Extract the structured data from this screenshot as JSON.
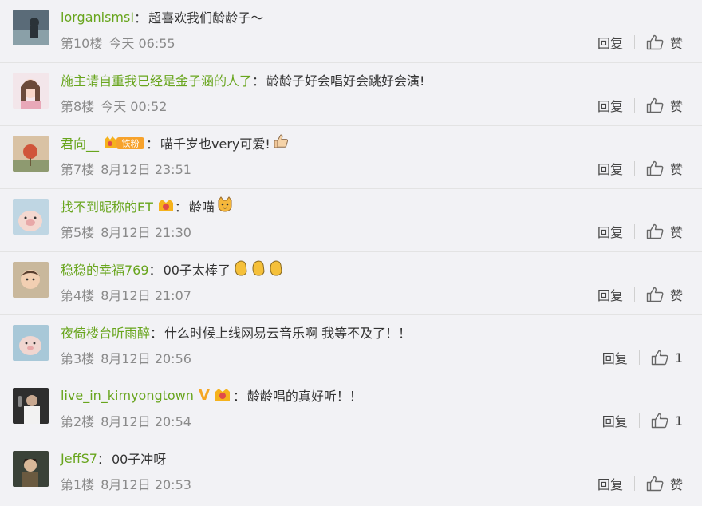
{
  "colors": {
    "username": "#68a51d",
    "meta": "#8a8a8a",
    "text": "#333333"
  },
  "comments": [
    {
      "user": "lorganismsI",
      "text": "超喜欢我们龄龄子～",
      "floor": "第10楼",
      "time": "今天 06:55",
      "reply": "回复",
      "like": "赞"
    },
    {
      "user": "施主请自重我已经是金子涵的人了",
      "text": "龄龄子好会唱好会跳好会演!",
      "floor": "第8楼",
      "time": "今天 00:52",
      "reply": "回复",
      "like": "赞"
    },
    {
      "user": "君向__",
      "badge": "铁粉",
      "text": "喵千岁也very可爱!",
      "emoji": "thumbs-up",
      "floor": "第7楼",
      "time": "8月12日 23:51",
      "reply": "回复",
      "like": "赞"
    },
    {
      "user": "找不到昵称的ET",
      "text": "龄喵",
      "emoji": "cat-face",
      "floor": "第5楼",
      "time": "8月12日 21:30",
      "reply": "回复",
      "like": "赞"
    },
    {
      "user": "稳稳的幸福769",
      "text": "00子太棒了",
      "emoji": "clap x3",
      "floor": "第4楼",
      "time": "8月12日 21:07",
      "reply": "回复",
      "like": "赞"
    },
    {
      "user": "夜倚楼台听雨醉",
      "text": "什么时候上线网易云音乐啊 我等不及了！！",
      "floor": "第3楼",
      "time": "8月12日 20:56",
      "reply": "回复",
      "like": "1"
    },
    {
      "user": "live_in_kimyongtown",
      "vbadge": "V",
      "text": "龄龄唱的真好听！！",
      "floor": "第2楼",
      "time": "8月12日 20:54",
      "reply": "回复",
      "like": "1"
    },
    {
      "user": "JeffS7",
      "text": "00子冲呀",
      "floor": "第1楼",
      "time": "8月12日 20:53",
      "reply": "回复",
      "like": "赞"
    }
  ]
}
